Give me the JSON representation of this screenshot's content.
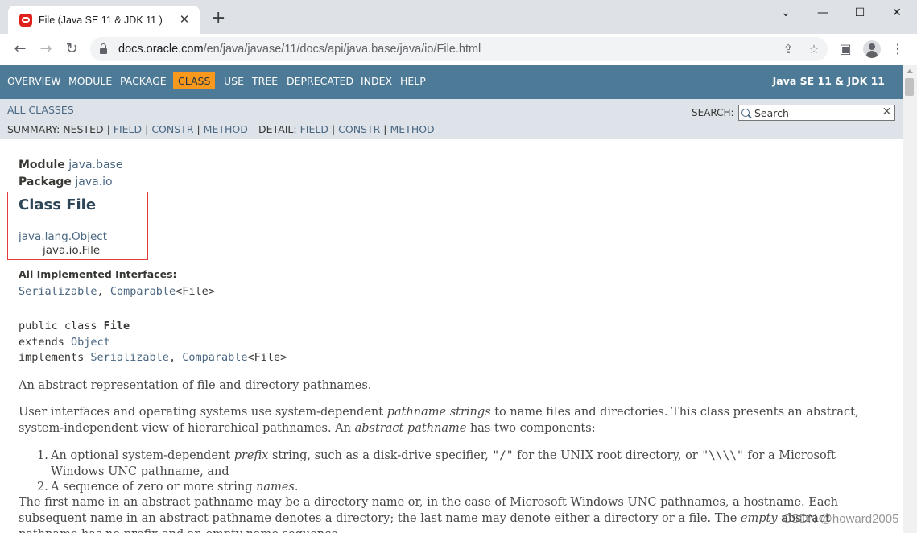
{
  "browser": {
    "tab_title": "File (Java SE 11 & JDK 11 )",
    "tab_close": "✕",
    "new_tab": "+",
    "url_host": "docs.oracle.com",
    "url_path": "/en/java/javase/11/docs/api/java.base/java/io/File.html",
    "window_controls": {
      "chevron": "⌄",
      "minimize": "—",
      "maximize": "☐",
      "close": "✕"
    },
    "nav": {
      "back": "←",
      "forward": "→",
      "reload": "↻"
    },
    "icons": {
      "share": "⇪",
      "star": "☆",
      "sidepanel": "▣",
      "menu": "⋮"
    }
  },
  "topnav": {
    "items": [
      "OVERVIEW",
      "MODULE",
      "PACKAGE",
      "CLASS",
      "USE",
      "TREE",
      "DEPRECATED",
      "INDEX",
      "HELP"
    ],
    "active": "CLASS",
    "title": "Java SE 11 & JDK 11"
  },
  "subnav": {
    "all_classes": "ALL CLASSES",
    "summary_label": "SUMMARY: NESTED |",
    "summary_links": [
      "FIELD",
      "CONSTR",
      "METHOD"
    ],
    "detail_label": "DETAIL:",
    "detail_links": [
      "FIELD",
      "CONSTR",
      "METHOD"
    ],
    "search_label": "SEARCH:",
    "search_placeholder": "Search",
    "search_reset": "✕"
  },
  "header": {
    "module_label": "Module",
    "module_value": "java.base",
    "package_label": "Package",
    "package_value": "java.io",
    "class_title": "Class File",
    "inheritance": [
      "java.lang.Object",
      "java.io.File"
    ],
    "interfaces_label": "All Implemented Interfaces:",
    "interfaces": [
      "Serializable",
      "Comparable",
      "<File>"
    ]
  },
  "signature": {
    "line1_prefix": "public class ",
    "line1_name": "File",
    "line2_prefix": "extends ",
    "line2_link": "Object",
    "line3_prefix": "implements ",
    "line3_link1": "Serializable",
    "line3_sep": ", ",
    "line3_link2": "Comparable",
    "line3_suffix": "<File>"
  },
  "description": {
    "p1": "An abstract representation of file and directory pathnames.",
    "p2_a": "User interfaces and operating systems use system-dependent ",
    "p2_i1": "pathname strings",
    "p2_b": " to name files and directories. This class presents an abstract, system-independent view of hierarchical pathnames. An ",
    "p2_i2": "abstract pathname",
    "p2_c": " has two components:",
    "li1_num": "1.",
    "li1_a": "An optional system-dependent ",
    "li1_i": "prefix",
    "li1_b": " string, such as a disk-drive specifier, ",
    "li1_c1": "\"/\"",
    "li1_c": " for the UNIX root directory, or ",
    "li1_c2": "\"\\\\\\\\\"",
    "li1_d": " for a Microsoft Windows UNC pathname, and",
    "li2_num": "2.",
    "li2_a": "A sequence of zero or more string ",
    "li2_i": "names",
    "li2_b": ".",
    "p3_a": "The first name in an abstract pathname may be a directory name or, in the case of Microsoft Windows UNC pathnames, a hostname. Each subsequent name in an abstract pathname denotes a directory; the last name may denote either a directory or a file. The ",
    "p3_i": "empty",
    "p3_b": " abstract pathname has no prefix and an empty name sequence."
  },
  "watermark": "CSDN @howard2005"
}
